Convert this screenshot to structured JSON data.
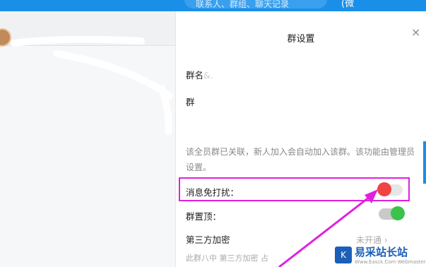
{
  "header": {
    "search_placeholder": "联系人、群组、聊天记录",
    "phone_label": "(微"
  },
  "panel": {
    "title": "群设置",
    "close_glyph": "×",
    "group_name_label": "群名",
    "group_name_value": "&.",
    "group_label": "群",
    "hint": "该全员群已关联，新人加入会自动加入该群。该功能由管理员设置。",
    "do_not_disturb_label": "消息免打扰：",
    "pin_label": "群置顶：",
    "third_party_label": "第三方加密",
    "third_party_status": "未开通",
    "third_party_desc": "此群八中 第三方加密 占"
  },
  "toggles": {
    "do_not_disturb": false,
    "pin_to_top": true
  },
  "watermark": {
    "title": "易采站长站",
    "subtitle": "Www.Easck.Com Webmaster"
  },
  "colors": {
    "header_blue": "#1a8fe8",
    "toggle_on": "#3bc24b",
    "toggle_off_knob": "#f04444",
    "annotation": "#e020e0"
  }
}
